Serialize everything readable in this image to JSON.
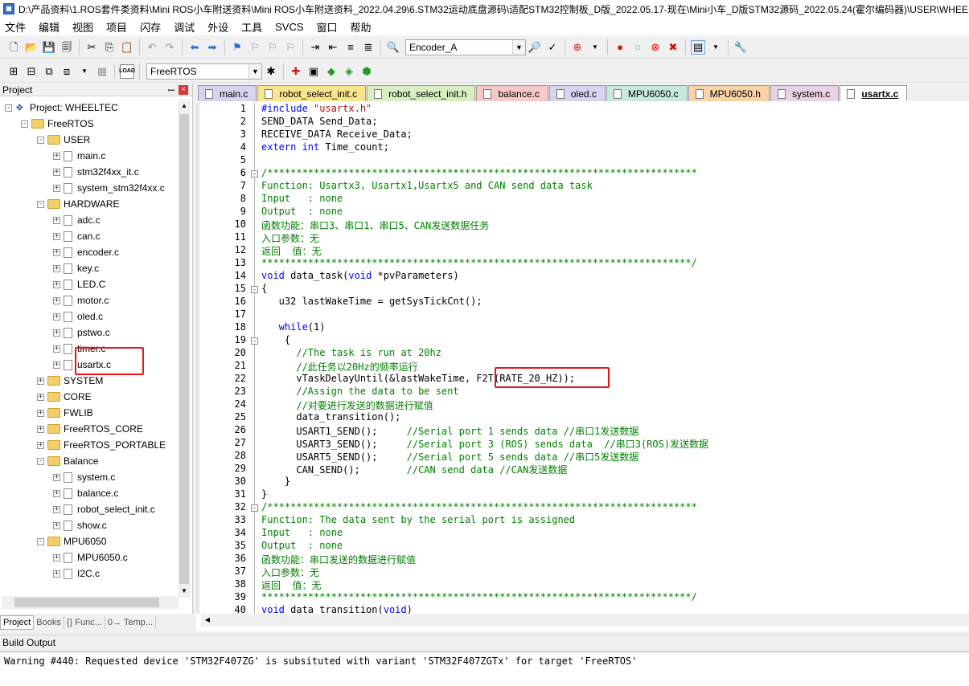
{
  "window": {
    "title": "D:\\产品资料\\1.ROS套件类资料\\Mini ROS小车附送资料\\Mini ROS小车附送资料_2022.04.29\\6.STM32运动底盘源码\\适配STM32控制板_D版_2022.05.17-现在\\Mini小车_D版STM32源码_2022.05.24(霍尔编码器)\\USER\\WHEELTEC.uvprojx"
  },
  "menu": [
    "文件",
    "编辑",
    "视图",
    "项目",
    "闪存",
    "调试",
    "外设",
    "工具",
    "SVCS",
    "窗口",
    "帮助"
  ],
  "toolbar": {
    "find_combo": "Encoder_A",
    "target_combo": "FreeRTOS",
    "load_label": "LOAD"
  },
  "project": {
    "header": "Project",
    "pin": "ꟷ",
    "close": "×",
    "root": "Project: WHEELTEC",
    "target": "FreeRTOS",
    "groups": [
      {
        "name": "USER",
        "files": [
          "main.c",
          "stm32f4xx_it.c",
          "system_stm32f4xx.c"
        ]
      },
      {
        "name": "HARDWARE",
        "files": [
          "adc.c",
          "can.c",
          "encoder.c",
          "key.c",
          "LED.C",
          "motor.c",
          "oled.c",
          "pstwo.c",
          "timer.c",
          "usartx.c"
        ]
      },
      {
        "name": "SYSTEM",
        "files": []
      },
      {
        "name": "CORE",
        "files": []
      },
      {
        "name": "FWLIB",
        "files": []
      },
      {
        "name": "FreeRTOS_CORE",
        "files": []
      },
      {
        "name": "FreeRTOS_PORTABLE",
        "files": []
      },
      {
        "name": "Balance",
        "files": [
          "system.c",
          "balance.c",
          "robot_select_init.c",
          "show.c"
        ]
      },
      {
        "name": "MPU6050",
        "files": [
          "MPU6050.c",
          "I2C.c"
        ]
      }
    ],
    "tabs": [
      "Project",
      "Books",
      "{} Func...",
      "0→ Temp..."
    ]
  },
  "editor": {
    "tabs": [
      {
        "name": "main.c",
        "color": "#d7d4f0"
      },
      {
        "name": "robot_select_init.c",
        "color": "#f8e58c"
      },
      {
        "name": "robot_select_init.h",
        "color": "#d9efc2"
      },
      {
        "name": "balance.c",
        "color": "#f8c9c9"
      },
      {
        "name": "oled.c",
        "color": "#d7d4f0"
      },
      {
        "name": "MPU6050.c",
        "color": "#c9e9de"
      },
      {
        "name": "MPU6050.h",
        "color": "#f9d2a8"
      },
      {
        "name": "system.c",
        "color": "#e9d2e4"
      },
      {
        "name": "usartx.c",
        "color": "#ffffff",
        "active": true
      }
    ],
    "lines": [
      {
        "n": "1",
        "f": "",
        "segs": [
          [
            "kw",
            "#include "
          ],
          [
            "str",
            "\"usartx.h\""
          ]
        ]
      },
      {
        "n": "2",
        "f": "",
        "segs": [
          [
            "",
            "SEND_DATA Send_Data;"
          ]
        ]
      },
      {
        "n": "3",
        "f": "",
        "segs": [
          [
            "",
            "RECEIVE_DATA Receive_Data;"
          ]
        ]
      },
      {
        "n": "4",
        "f": "",
        "segs": [
          [
            "kw",
            "extern int"
          ],
          [
            "",
            " Time_count;"
          ]
        ]
      },
      {
        "n": "5",
        "f": "",
        "segs": []
      },
      {
        "n": "6",
        "f": "-",
        "segs": [
          [
            "cm",
            "/**************************************************************************"
          ]
        ]
      },
      {
        "n": "7",
        "f": "",
        "segs": [
          [
            "cm",
            "Function: Usartx3, Usartx1,Usartx5 and CAN send data task"
          ]
        ]
      },
      {
        "n": "8",
        "f": "",
        "segs": [
          [
            "cm",
            "Input   : none"
          ]
        ]
      },
      {
        "n": "9",
        "f": "",
        "segs": [
          [
            "cm",
            "Output  : none"
          ]
        ]
      },
      {
        "n": "10",
        "f": "",
        "segs": [
          [
            "cm",
            "函数功能：串口3、串口1、串口5、CAN发送数据任务"
          ]
        ]
      },
      {
        "n": "11",
        "f": "",
        "segs": [
          [
            "cm",
            "入口参数：无"
          ]
        ]
      },
      {
        "n": "12",
        "f": "",
        "segs": [
          [
            "cm",
            "返回  值：无"
          ]
        ]
      },
      {
        "n": "13",
        "f": "",
        "segs": [
          [
            "cm",
            "**************************************************************************/"
          ]
        ]
      },
      {
        "n": "14",
        "f": "",
        "segs": [
          [
            "kw",
            "void"
          ],
          [
            "",
            " data_task("
          ],
          [
            "kw",
            "void"
          ],
          [
            "",
            " *pvParameters)"
          ]
        ]
      },
      {
        "n": "15",
        "f": "-",
        "segs": [
          [
            "",
            "{"
          ]
        ]
      },
      {
        "n": "16",
        "f": "",
        "segs": [
          [
            "",
            "   u32 lastWakeTime = getSysTickCnt();"
          ]
        ]
      },
      {
        "n": "17",
        "f": "",
        "segs": []
      },
      {
        "n": "18",
        "f": "",
        "segs": [
          [
            "kw",
            "   while"
          ],
          [
            "",
            "(1)"
          ]
        ]
      },
      {
        "n": "19",
        "f": "-",
        "segs": [
          [
            "",
            "    {"
          ]
        ]
      },
      {
        "n": "20",
        "f": "",
        "segs": [
          [
            "cm",
            "      //The task is run at 20hz"
          ]
        ]
      },
      {
        "n": "21",
        "f": "",
        "segs": [
          [
            "cm",
            "      //此任务以20Hz的频率运行"
          ]
        ]
      },
      {
        "n": "22",
        "f": "",
        "segs": [
          [
            "",
            "      vTaskDelayUntil(&lastWakeTime, F2T(RATE_20_HZ));"
          ]
        ]
      },
      {
        "n": "23",
        "f": "",
        "segs": [
          [
            "cm",
            "      //Assign the data to be sent"
          ]
        ]
      },
      {
        "n": "24",
        "f": "",
        "segs": [
          [
            "cm",
            "      //对要进行发送的数据进行赋值"
          ]
        ]
      },
      {
        "n": "25",
        "f": "",
        "segs": [
          [
            "",
            "      data_transition();"
          ]
        ]
      },
      {
        "n": "26",
        "f": "",
        "segs": [
          [
            "",
            "      USART1_SEND();     "
          ],
          [
            "cm",
            "//Serial port 1 sends data //串口1发送数据"
          ]
        ]
      },
      {
        "n": "27",
        "f": "",
        "segs": [
          [
            "",
            "      USART3_SEND();     "
          ],
          [
            "cm",
            "//Serial port 3 (ROS) sends data  //串口3(ROS)发送数据"
          ]
        ]
      },
      {
        "n": "28",
        "f": "",
        "segs": [
          [
            "",
            "      USART5_SEND();     "
          ],
          [
            "cm",
            "//Serial port 5 sends data //串口5发送数据"
          ]
        ]
      },
      {
        "n": "29",
        "f": "",
        "segs": [
          [
            "",
            "      CAN_SEND();        "
          ],
          [
            "cm",
            "//CAN send data //CAN发送数据"
          ]
        ]
      },
      {
        "n": "30",
        "f": "",
        "segs": [
          [
            "",
            "    }"
          ]
        ]
      },
      {
        "n": "31",
        "f": "",
        "segs": [
          [
            "",
            "}"
          ]
        ]
      },
      {
        "n": "32",
        "f": "-",
        "segs": [
          [
            "cm",
            "/**************************************************************************"
          ]
        ]
      },
      {
        "n": "33",
        "f": "",
        "segs": [
          [
            "cm",
            "Function: The data sent by the serial port is assigned"
          ]
        ]
      },
      {
        "n": "34",
        "f": "",
        "segs": [
          [
            "cm",
            "Input   : none"
          ]
        ]
      },
      {
        "n": "35",
        "f": "",
        "segs": [
          [
            "cm",
            "Output  : none"
          ]
        ]
      },
      {
        "n": "36",
        "f": "",
        "segs": [
          [
            "cm",
            "函数功能：串口发送的数据进行赋值"
          ]
        ]
      },
      {
        "n": "37",
        "f": "",
        "segs": [
          [
            "cm",
            "入口参数：无"
          ]
        ]
      },
      {
        "n": "38",
        "f": "",
        "segs": [
          [
            "cm",
            "返回  值：无"
          ]
        ]
      },
      {
        "n": "39",
        "f": "",
        "segs": [
          [
            "cm",
            "**************************************************************************/"
          ]
        ]
      },
      {
        "n": "40",
        "f": "",
        "segs": [
          [
            "kw",
            "void"
          ],
          [
            "",
            " data_transition("
          ],
          [
            "kw",
            "void"
          ],
          [
            "",
            ")"
          ]
        ]
      }
    ]
  },
  "build": {
    "header": "Build Output",
    "text": "Warning #440: Requested device 'STM32F407ZG' is subsituted with variant 'STM32F407ZGTx' for target 'FreeRTOS'"
  },
  "colors": {
    "highlight_box": "#e8141c",
    "comment": "#008000",
    "keyword": "#0000ff",
    "string": "#a31515"
  }
}
